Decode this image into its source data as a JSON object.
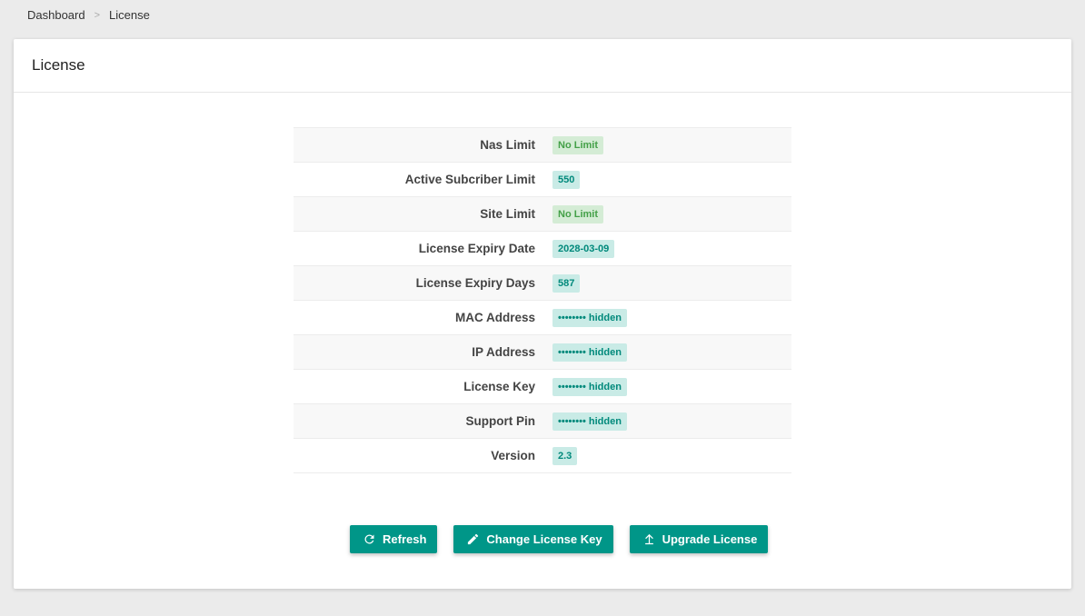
{
  "breadcrumb": {
    "items": [
      "Dashboard",
      "License"
    ],
    "separator": ">"
  },
  "card": {
    "title": "License"
  },
  "rows": [
    {
      "label": "Nas Limit",
      "value": "No Limit",
      "style": "green"
    },
    {
      "label": "Active Subcriber Limit",
      "value": "550",
      "style": "teal"
    },
    {
      "label": "Site Limit",
      "value": "No Limit",
      "style": "green"
    },
    {
      "label": "License Expiry Date",
      "value": "2028-03-09",
      "style": "teal"
    },
    {
      "label": "License Expiry Days",
      "value": "587",
      "style": "teal"
    },
    {
      "label": "MAC Address",
      "value": "•••••••• hidden",
      "style": "teal"
    },
    {
      "label": "IP Address",
      "value": "•••••••• hidden",
      "style": "teal"
    },
    {
      "label": "License Key",
      "value": "•••••••• hidden",
      "style": "teal"
    },
    {
      "label": "Support Pin",
      "value": "•••••••• hidden",
      "style": "teal"
    },
    {
      "label": "Version",
      "value": "2.3",
      "style": "teal"
    }
  ],
  "buttons": {
    "refresh": {
      "label": "Refresh",
      "icon": "refresh-icon"
    },
    "change_key": {
      "label": "Change License Key",
      "icon": "pencil-icon"
    },
    "upgrade": {
      "label": "Upgrade License",
      "icon": "upload-icon"
    }
  },
  "colors": {
    "primary": "#009688",
    "badge_green_bg": "#d4ecd5",
    "badge_green_text": "#43a047",
    "badge_teal_bg": "#c9ebe6",
    "badge_teal_text": "#00897b"
  }
}
